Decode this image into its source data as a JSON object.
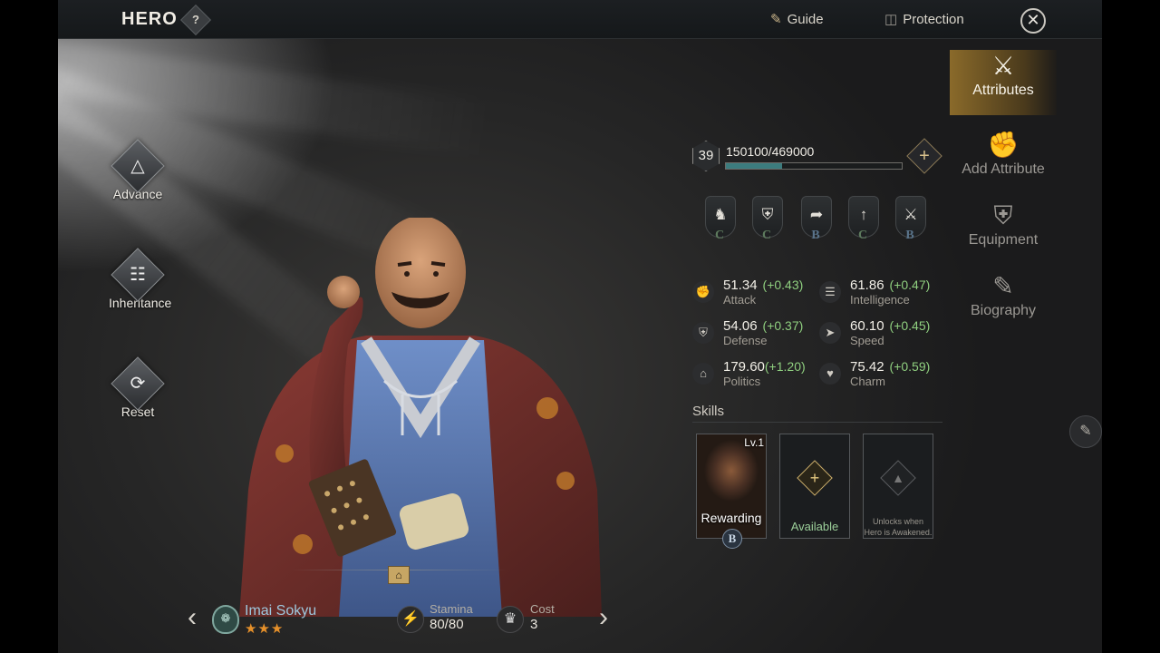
{
  "header": {
    "title": "HERO",
    "help_label": "?",
    "guide_label": "Guide",
    "protection_label": "Protection"
  },
  "side_actions": [
    {
      "label": "Advance",
      "icon": "advance-icon"
    },
    {
      "label": "Inheritance",
      "icon": "book-icon"
    },
    {
      "label": "Reset",
      "icon": "helmet-reset-icon"
    }
  ],
  "hero": {
    "name": "Imai Sokyu",
    "stars": "★★★",
    "star_count": 3,
    "stamina_label": "Stamina",
    "stamina_value": "80/80",
    "cost_label": "Cost",
    "cost_value": "3"
  },
  "level": {
    "value": "39",
    "exp_text": "150100/469000",
    "exp_fraction": 0.32
  },
  "troop_grades": [
    {
      "icon": "cavalry-icon",
      "grade": "C"
    },
    {
      "icon": "shield-infantry-icon",
      "grade": "C"
    },
    {
      "icon": "archer-icon",
      "grade": "B"
    },
    {
      "icon": "spear-icon",
      "grade": "C"
    },
    {
      "icon": "siege-icon",
      "grade": "B"
    }
  ],
  "attributes": {
    "attack": {
      "value": "51.34",
      "bonus": "(+0.43)",
      "label": "Attack"
    },
    "intelligence": {
      "value": "61.86",
      "bonus": "(+0.47)",
      "label": "Intelligence"
    },
    "defense": {
      "value": "54.06",
      "bonus": "(+0.37)",
      "label": "Defense"
    },
    "speed": {
      "value": "60.10",
      "bonus": "(+0.45)",
      "label": "Speed"
    },
    "politics": {
      "value": "179.60",
      "bonus": "(+1.20)",
      "label": "Politics"
    },
    "charm": {
      "value": "75.42",
      "bonus": "(+0.59)",
      "label": "Charm"
    }
  },
  "skills": {
    "title": "Skills",
    "slot1": {
      "level": "Lv.1",
      "name": "Rewarding",
      "grade": "B"
    },
    "slot2": {
      "label": "Available"
    },
    "slot3": {
      "label": "Unlocks when Hero is Awakened."
    }
  },
  "tabs": [
    {
      "label": "Attributes",
      "active": true
    },
    {
      "label": "Add Attribute",
      "active": false
    },
    {
      "label": "Equipment",
      "active": false
    },
    {
      "label": "Biography",
      "active": false
    }
  ],
  "colors": {
    "accent_gold": "#c9ac6a",
    "bonus_green": "#8fcf7f",
    "hero_name_blue": "#9ec8de",
    "star_orange": "#e6902a"
  }
}
